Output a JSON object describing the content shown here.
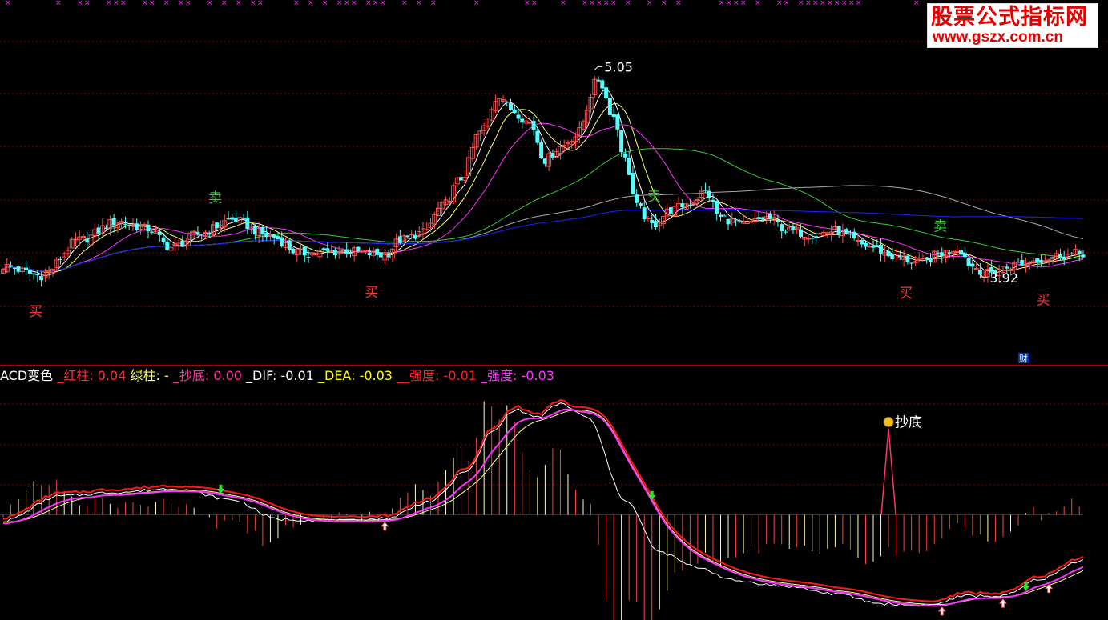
{
  "watermark": {
    "line1": "股票公式指标网",
    "line2": "www.gszx.com.cn"
  },
  "indicator_bar": [
    {
      "label": "ACD变色",
      "value": "",
      "color": "#ffffff"
    },
    {
      "label": " _红柱: ",
      "value": "0.04",
      "color": "#ff3030"
    },
    {
      "label": " 绿柱: ",
      "value": "-",
      "color": "#ffff66"
    },
    {
      "label": " _抄底: ",
      "value": "0.00",
      "color": "#ff3399"
    },
    {
      "label": " _DIF: ",
      "value": "-0.01",
      "color": "#ffffff"
    },
    {
      "label": " _DEA: ",
      "value": "-0.03",
      "color": "#ffff00"
    },
    {
      "label": " __强度: ",
      "value": "-0.01",
      "color": "#ff2020"
    },
    {
      "label": " _强度: ",
      "value": "-0.03",
      "color": "#ff33ff"
    }
  ],
  "colors": {
    "up": "#ff5050",
    "down": "#54ffff",
    "grid": "#8b0000",
    "ma5": "#ffffff",
    "ma10": "#ffff66",
    "ma20": "#ff33ff",
    "ma60": "#33cc33",
    "ma120": "#aaaaaa",
    "ma250": "#2020ff",
    "dif": "#ffffff",
    "dea": "#ffff88",
    "strength_red": "#ff1818",
    "strength_pink": "#ff33ff",
    "buy_label": "#ff3333",
    "sell_label": "#33cc33"
  },
  "chart_data": [
    {
      "type": "candlestick",
      "price_range": [
        3.5,
        5.3
      ],
      "annotations": {
        "high": {
          "text": "5.05",
          "value": 5.05
        },
        "low": {
          "text": "3.92",
          "value": 3.92
        },
        "buy": [
          "买",
          "买",
          "买",
          "买"
        ],
        "sell": [
          "卖",
          "卖",
          "卖"
        ],
        "finance_badge": "财"
      },
      "anchors": [
        [
          0,
          3.98
        ],
        [
          10,
          3.93
        ],
        [
          20,
          4.12
        ],
        [
          30,
          4.22
        ],
        [
          38,
          4.18
        ],
        [
          44,
          4.08
        ],
        [
          52,
          4.16
        ],
        [
          60,
          4.23
        ],
        [
          70,
          4.14
        ],
        [
          78,
          4.05
        ],
        [
          90,
          4.06
        ],
        [
          100,
          4.04
        ],
        [
          104,
          4.12
        ],
        [
          110,
          4.16
        ],
        [
          115,
          4.3
        ],
        [
          120,
          4.45
        ],
        [
          125,
          4.7
        ],
        [
          130,
          4.9
        ],
        [
          133,
          4.82
        ],
        [
          138,
          4.75
        ],
        [
          142,
          4.55
        ],
        [
          146,
          4.62
        ],
        [
          150,
          4.68
        ],
        [
          156,
          4.98
        ],
        [
          160,
          4.78
        ],
        [
          163,
          4.55
        ],
        [
          166,
          4.3
        ],
        [
          170,
          4.2
        ],
        [
          175,
          4.28
        ],
        [
          180,
          4.32
        ],
        [
          184,
          4.38
        ],
        [
          188,
          4.24
        ],
        [
          194,
          4.2
        ],
        [
          200,
          4.24
        ],
        [
          206,
          4.17
        ],
        [
          212,
          4.15
        ],
        [
          218,
          4.17
        ],
        [
          226,
          4.09
        ],
        [
          234,
          4.03
        ],
        [
          240,
          4.0
        ],
        [
          246,
          4.05
        ],
        [
          250,
          4.08
        ],
        [
          254,
          3.98
        ],
        [
          258,
          3.94
        ],
        [
          262,
          3.97
        ],
        [
          267,
          4.0
        ],
        [
          272,
          4.02
        ],
        [
          278,
          4.04
        ],
        [
          283,
          4.05
        ]
      ],
      "candle_count": 284,
      "moving_averages": [
        "MA5",
        "MA10",
        "MA20",
        "MA60",
        "MA120",
        "MA250"
      ]
    },
    {
      "type": "bar+line",
      "name_text": "ACD变色",
      "value_range": [
        -0.14,
        0.19
      ],
      "annotation": {
        "text": "抄底",
        "value": 0.12
      },
      "anchors": [
        [
          0,
          -0.008
        ],
        [
          15,
          0.025
        ],
        [
          30,
          0.03
        ],
        [
          45,
          0.035
        ],
        [
          60,
          0.02
        ],
        [
          72,
          -0.006
        ],
        [
          90,
          -0.008
        ],
        [
          100,
          -0.005
        ],
        [
          112,
          0.018
        ],
        [
          122,
          0.06
        ],
        [
          128,
          0.11
        ],
        [
          134,
          0.14
        ],
        [
          140,
          0.13
        ],
        [
          146,
          0.148
        ],
        [
          153,
          0.13
        ],
        [
          163,
          0.02
        ],
        [
          172,
          -0.05
        ],
        [
          182,
          -0.07
        ],
        [
          192,
          -0.088
        ],
        [
          205,
          -0.095
        ],
        [
          218,
          -0.105
        ],
        [
          230,
          -0.118
        ],
        [
          238,
          -0.12
        ],
        [
          243,
          -0.12
        ],
        [
          252,
          -0.108
        ],
        [
          262,
          -0.108
        ],
        [
          272,
          -0.085
        ],
        [
          283,
          -0.06
        ]
      ],
      "spike": {
        "index": 232,
        "value": 0.115
      },
      "bar_count": 284
    }
  ]
}
